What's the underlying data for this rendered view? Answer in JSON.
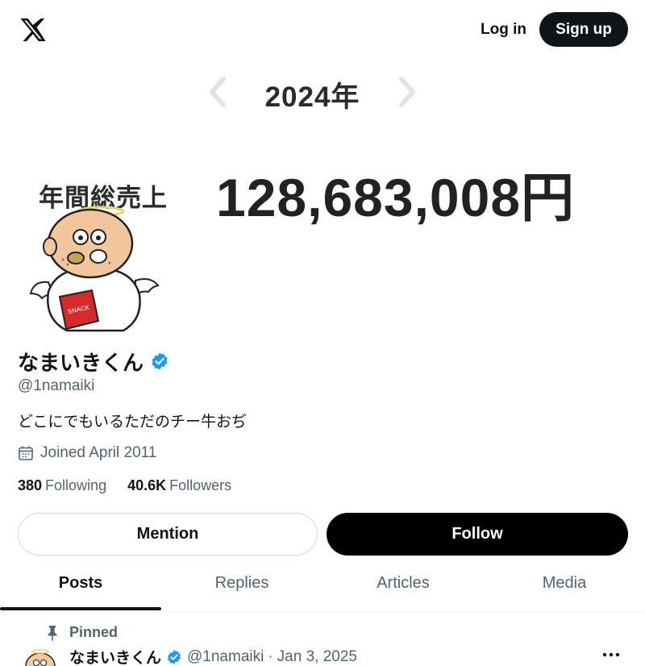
{
  "topbar": {
    "logo": "x-logo-icon",
    "login_label": "Log in",
    "signup_label": "Sign up"
  },
  "banner": {
    "year": "2024年",
    "annual_label": "年間総売上",
    "amount": "128,683,008円",
    "avatar_bag_text": "SNACK"
  },
  "profile": {
    "display_name": "なまいきくん",
    "handle": "@1namaiki",
    "bio": "どこにでもいるただのチー牛おぢ",
    "joined": "Joined April 2011",
    "following_count": "380",
    "following_label": "Following",
    "followers_count": "40.6K",
    "followers_label": "Followers"
  },
  "actions": {
    "mention_label": "Mention",
    "follow_label": "Follow"
  },
  "tabs": [
    {
      "label": "Posts",
      "active": true
    },
    {
      "label": "Replies",
      "active": false
    },
    {
      "label": "Articles",
      "active": false
    },
    {
      "label": "Media",
      "active": false
    }
  ],
  "pinned_post": {
    "pinned_label": "Pinned",
    "author_name": "なまいきくん",
    "author_handle": "@1namaiki",
    "separator": "·",
    "date": "Jan 3, 2025"
  },
  "colors": {
    "text_primary": "#0f1419",
    "text_secondary": "#536471",
    "verified_blue": "#1d9bf0",
    "button_dark": "#0f1419",
    "border": "#cfd9de"
  }
}
